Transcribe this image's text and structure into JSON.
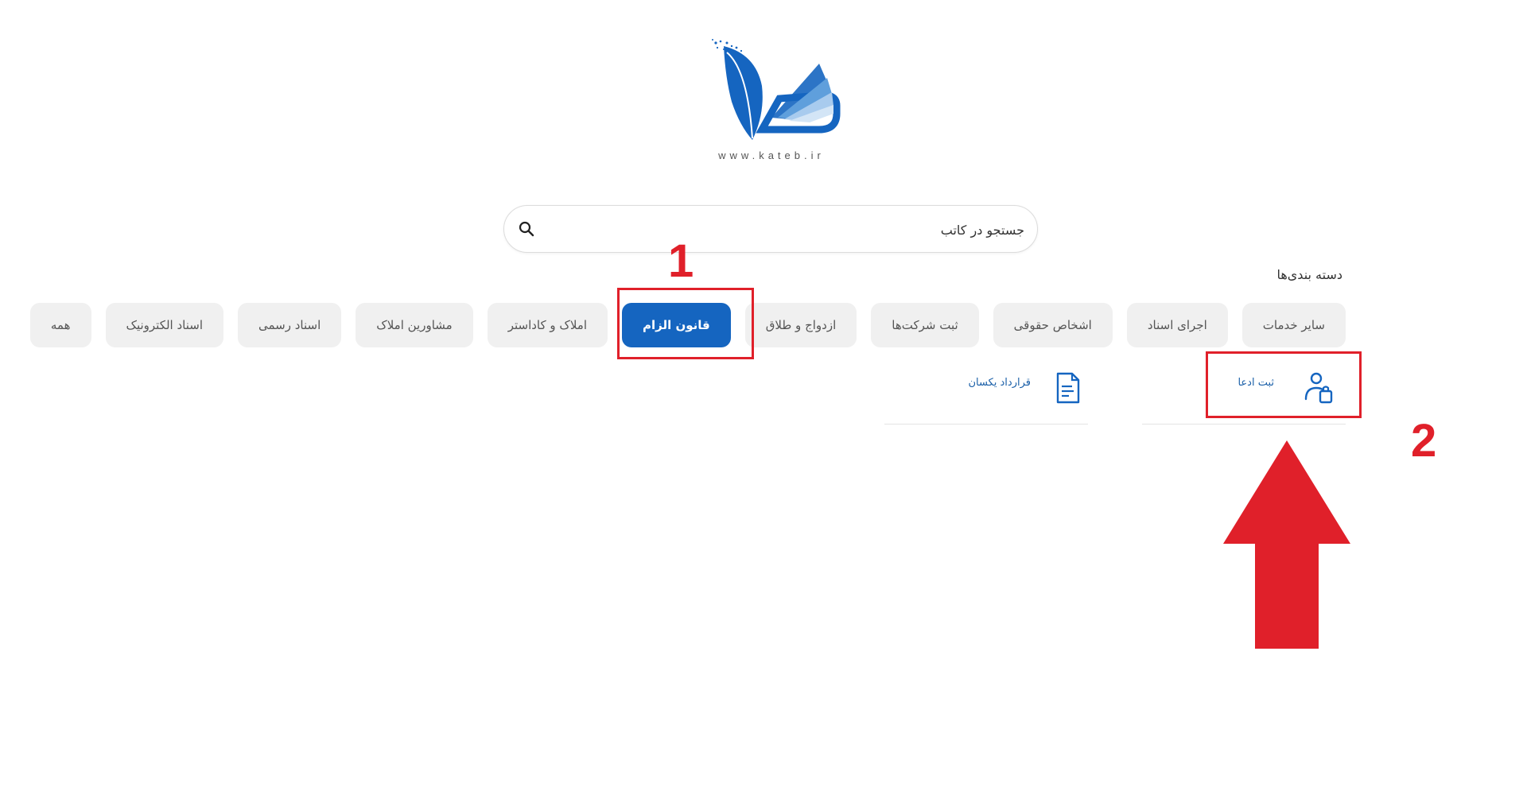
{
  "logo": {
    "url_text": "www.kateb.ir",
    "colors": {
      "primary": "#1565c0",
      "light": "#90bde9",
      "lighter": "#c6ddf3"
    }
  },
  "search": {
    "placeholder": "جستجو در کاتب",
    "icon": "search-icon"
  },
  "categories": {
    "heading": "دسته بندی‌ها",
    "chips": [
      {
        "label": "همه",
        "active": false
      },
      {
        "label": "اسناد الکترونیک",
        "active": false
      },
      {
        "label": "اسناد رسمی",
        "active": false
      },
      {
        "label": "مشاورین املاک",
        "active": false
      },
      {
        "label": "املاک و کاداستر",
        "active": false
      },
      {
        "label": "قانون الزام",
        "active": true
      },
      {
        "label": "ازدواج و طلاق",
        "active": false
      },
      {
        "label": "ثبت شرکت‌ها",
        "active": false
      },
      {
        "label": "اشخاص حقوقی",
        "active": false
      },
      {
        "label": "اجرای اسناد",
        "active": false
      },
      {
        "label": "سایر خدمات",
        "active": false
      }
    ]
  },
  "services": [
    {
      "label": "ثبت ادعا",
      "icon": "user-document-icon"
    },
    {
      "label": "قرارداد یکسان",
      "icon": "document-icon"
    }
  ],
  "annotations": {
    "step1": "1",
    "step2": "2",
    "color": "#e0202a"
  }
}
